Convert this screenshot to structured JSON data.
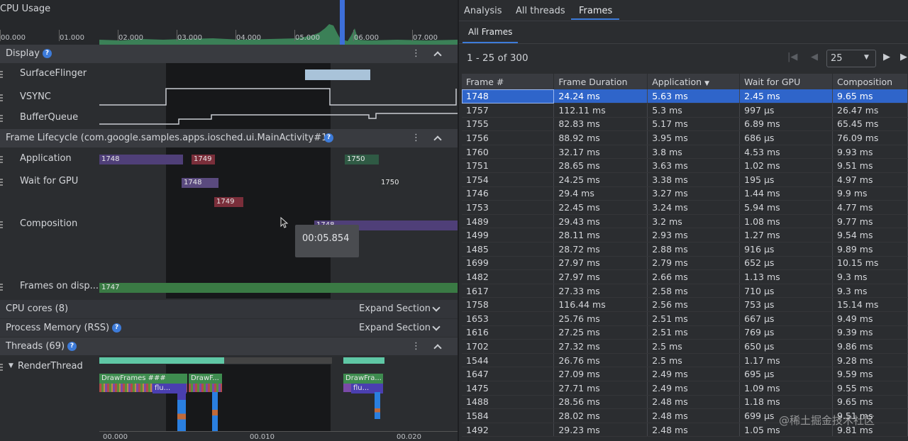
{
  "cpu": {
    "title": "CPU Usage",
    "ticks": [
      "00.000",
      "01.000",
      "02.000",
      "03.000",
      "04.000",
      "05.000",
      "06.000",
      "07.000"
    ]
  },
  "display": {
    "title": "Display",
    "rows": [
      "SurfaceFlinger",
      "VSYNC",
      "BufferQueue"
    ]
  },
  "lifecycle": {
    "title": "Frame Lifecycle (com.google.samples.apps.iosched.ui.MainActivity#1)",
    "rows": {
      "application": "Application",
      "wait_gpu": "Wait for GPU",
      "composition": "Composition",
      "frames_on_display": "Frames on disp..."
    },
    "bars": {
      "app_a": "1748",
      "app_b": "1749",
      "app_c": "1750",
      "gpu_a": "1748",
      "gpu_b": "1749",
      "gpu_c": "1750",
      "comp_a": "1748",
      "display_a": "1747"
    },
    "tooltip": "00:05.854"
  },
  "cpu_cores": {
    "title": "CPU cores (8)",
    "expand": "Expand Section"
  },
  "process_memory": {
    "title": "Process Memory (RSS)",
    "expand": "Expand Section"
  },
  "threads": {
    "title": "Threads (69)",
    "render_thread": "RenderThread",
    "slices": {
      "a": "DrawFrames ###",
      "b": "DrawF...",
      "c": "DrawFra...",
      "d": "flu...",
      "e": "flu..."
    },
    "ticks": [
      "00.000",
      "00.010",
      "00.020"
    ]
  },
  "right": {
    "tabs": [
      "Analysis",
      "All threads",
      "Frames"
    ],
    "active_tab": "Frames",
    "subtab": "All Frames",
    "pagination": "1 - 25 of 300",
    "page_size": "25",
    "columns": [
      "Frame #",
      "Frame Duration",
      "Application",
      "Wait for GPU",
      "Composition"
    ],
    "rows": [
      [
        "1748",
        "24.24 ms",
        "5.63 ms",
        "2.45 ms",
        "9.65 ms"
      ],
      [
        "1757",
        "112.11 ms",
        "5.3 ms",
        "997 µs",
        "26.47 ms"
      ],
      [
        "1755",
        "82.83 ms",
        "5.17 ms",
        "6.89 ms",
        "65.45 ms"
      ],
      [
        "1756",
        "88.92 ms",
        "3.95 ms",
        "686 µs",
        "76.09 ms"
      ],
      [
        "1760",
        "32.17 ms",
        "3.8 ms",
        "4.53 ms",
        "9.93 ms"
      ],
      [
        "1751",
        "28.65 ms",
        "3.63 ms",
        "1.02 ms",
        "9.51 ms"
      ],
      [
        "1754",
        "24.25 ms",
        "3.38 ms",
        "195 µs",
        "4.97 ms"
      ],
      [
        "1746",
        "29.4 ms",
        "3.27 ms",
        "1.44 ms",
        "9.9 ms"
      ],
      [
        "1753",
        "22.45 ms",
        "3.24 ms",
        "5.94 ms",
        "4.77 ms"
      ],
      [
        "1489",
        "29.43 ms",
        "3.2 ms",
        "1.08 ms",
        "9.77 ms"
      ],
      [
        "1499",
        "28.11 ms",
        "2.93 ms",
        "1.27 ms",
        "9.54 ms"
      ],
      [
        "1485",
        "28.72 ms",
        "2.88 ms",
        "916 µs",
        "9.89 ms"
      ],
      [
        "1699",
        "27.97 ms",
        "2.79 ms",
        "652 µs",
        "10.15 ms"
      ],
      [
        "1482",
        "27.97 ms",
        "2.66 ms",
        "1.13 ms",
        "9.3 ms"
      ],
      [
        "1617",
        "27.33 ms",
        "2.58 ms",
        "710 µs",
        "9.3 ms"
      ],
      [
        "1758",
        "116.44 ms",
        "2.56 ms",
        "753 µs",
        "15.14 ms"
      ],
      [
        "1653",
        "25.76 ms",
        "2.51 ms",
        "667 µs",
        "9.49 ms"
      ],
      [
        "1616",
        "27.25 ms",
        "2.51 ms",
        "769 µs",
        "9.39 ms"
      ],
      [
        "1702",
        "27.32 ms",
        "2.5 ms",
        "650 µs",
        "9.86 ms"
      ],
      [
        "1544",
        "26.76 ms",
        "2.5 ms",
        "1.17 ms",
        "9.28 ms"
      ],
      [
        "1647",
        "27.09 ms",
        "2.49 ms",
        "695 µs",
        "9.59 ms"
      ],
      [
        "1475",
        "27.71 ms",
        "2.49 ms",
        "1.09 ms",
        "9.55 ms"
      ],
      [
        "1488",
        "28.56 ms",
        "2.48 ms",
        "1.18 ms",
        "9.65 ms"
      ],
      [
        "1584",
        "28.02 ms",
        "2.48 ms",
        "699 µs",
        "9.51 ms"
      ],
      [
        "1492",
        "29.23 ms",
        "2.48 ms",
        "1.05 ms",
        "9.81 ms"
      ]
    ],
    "selected_index": 0
  },
  "watermark": "@稀土掘金技术社区",
  "colors": {
    "selection": "#2f65ca",
    "application": "#4f3f78",
    "gpu": "#5a4a7e",
    "composition_red": "#7a2e3a",
    "display_green": "#3a7a44",
    "cpu_green": "#3f8f5f",
    "cpu_cursor": "#3d6fd9"
  }
}
